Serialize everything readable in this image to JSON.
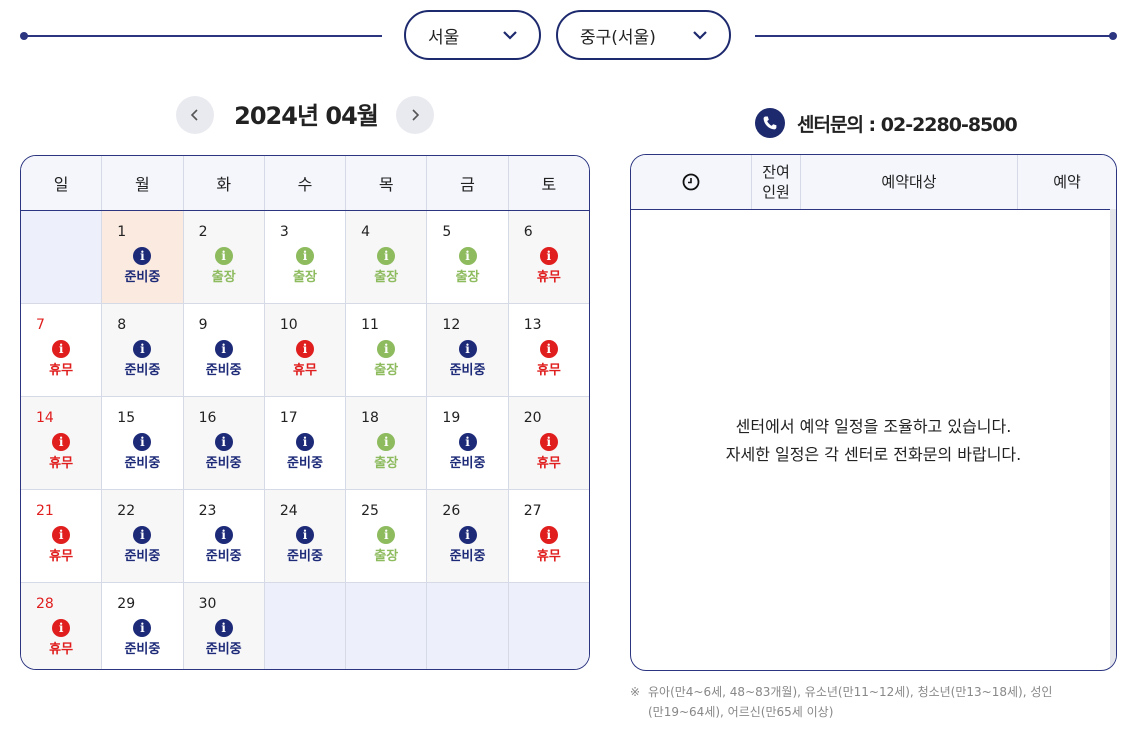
{
  "filters": {
    "region": "서울",
    "district": "중구(서울)"
  },
  "calendar": {
    "title": "2024년 04월",
    "weekdays": [
      "일",
      "월",
      "화",
      "수",
      "목",
      "금",
      "토"
    ],
    "days": [
      {
        "num": "1",
        "status": "준비중"
      },
      {
        "num": "2",
        "status": "출장"
      },
      {
        "num": "3",
        "status": "출장"
      },
      {
        "num": "4",
        "status": "출장"
      },
      {
        "num": "5",
        "status": "출장"
      },
      {
        "num": "6",
        "status": "휴무"
      },
      {
        "num": "7",
        "status": "휴무"
      },
      {
        "num": "8",
        "status": "준비중"
      },
      {
        "num": "9",
        "status": "준비중"
      },
      {
        "num": "10",
        "status": "휴무"
      },
      {
        "num": "11",
        "status": "출장"
      },
      {
        "num": "12",
        "status": "준비중"
      },
      {
        "num": "13",
        "status": "휴무"
      },
      {
        "num": "14",
        "status": "휴무"
      },
      {
        "num": "15",
        "status": "준비중"
      },
      {
        "num": "16",
        "status": "준비중"
      },
      {
        "num": "17",
        "status": "준비중"
      },
      {
        "num": "18",
        "status": "출장"
      },
      {
        "num": "19",
        "status": "준비중"
      },
      {
        "num": "20",
        "status": "휴무"
      },
      {
        "num": "21",
        "status": "휴무"
      },
      {
        "num": "22",
        "status": "준비중"
      },
      {
        "num": "23",
        "status": "준비중"
      },
      {
        "num": "24",
        "status": "준비중"
      },
      {
        "num": "25",
        "status": "출장"
      },
      {
        "num": "26",
        "status": "준비중"
      },
      {
        "num": "27",
        "status": "휴무"
      },
      {
        "num": "28",
        "status": "휴무"
      },
      {
        "num": "29",
        "status": "준비중"
      },
      {
        "num": "30",
        "status": "준비중"
      }
    ],
    "status_colors": {
      "준비중": "#1d2a78",
      "출장": "#8dbb5e",
      "휴무": "#e01e1e"
    },
    "info_glyph": "i"
  },
  "contact": {
    "label": "센터문의 : 02-2280-8500"
  },
  "panel": {
    "headers": [
      "",
      "잔여\n인원",
      "예약대상",
      "예약"
    ],
    "message_line1": "센터에서 예약 일정을 조율하고 있습니다.",
    "message_line2": "자세한 일정은 각 센터로 전화문의 바랍니다."
  },
  "note": {
    "mark": "※",
    "text": "유아(만4~6세, 48~83개월), 유소년(만11~12세), 청소년(만13~18세), 성인(만19~64세), 어르신(만65세 이상)"
  },
  "colors": {
    "accent": "#2b3580",
    "today": "#fbeadf"
  }
}
